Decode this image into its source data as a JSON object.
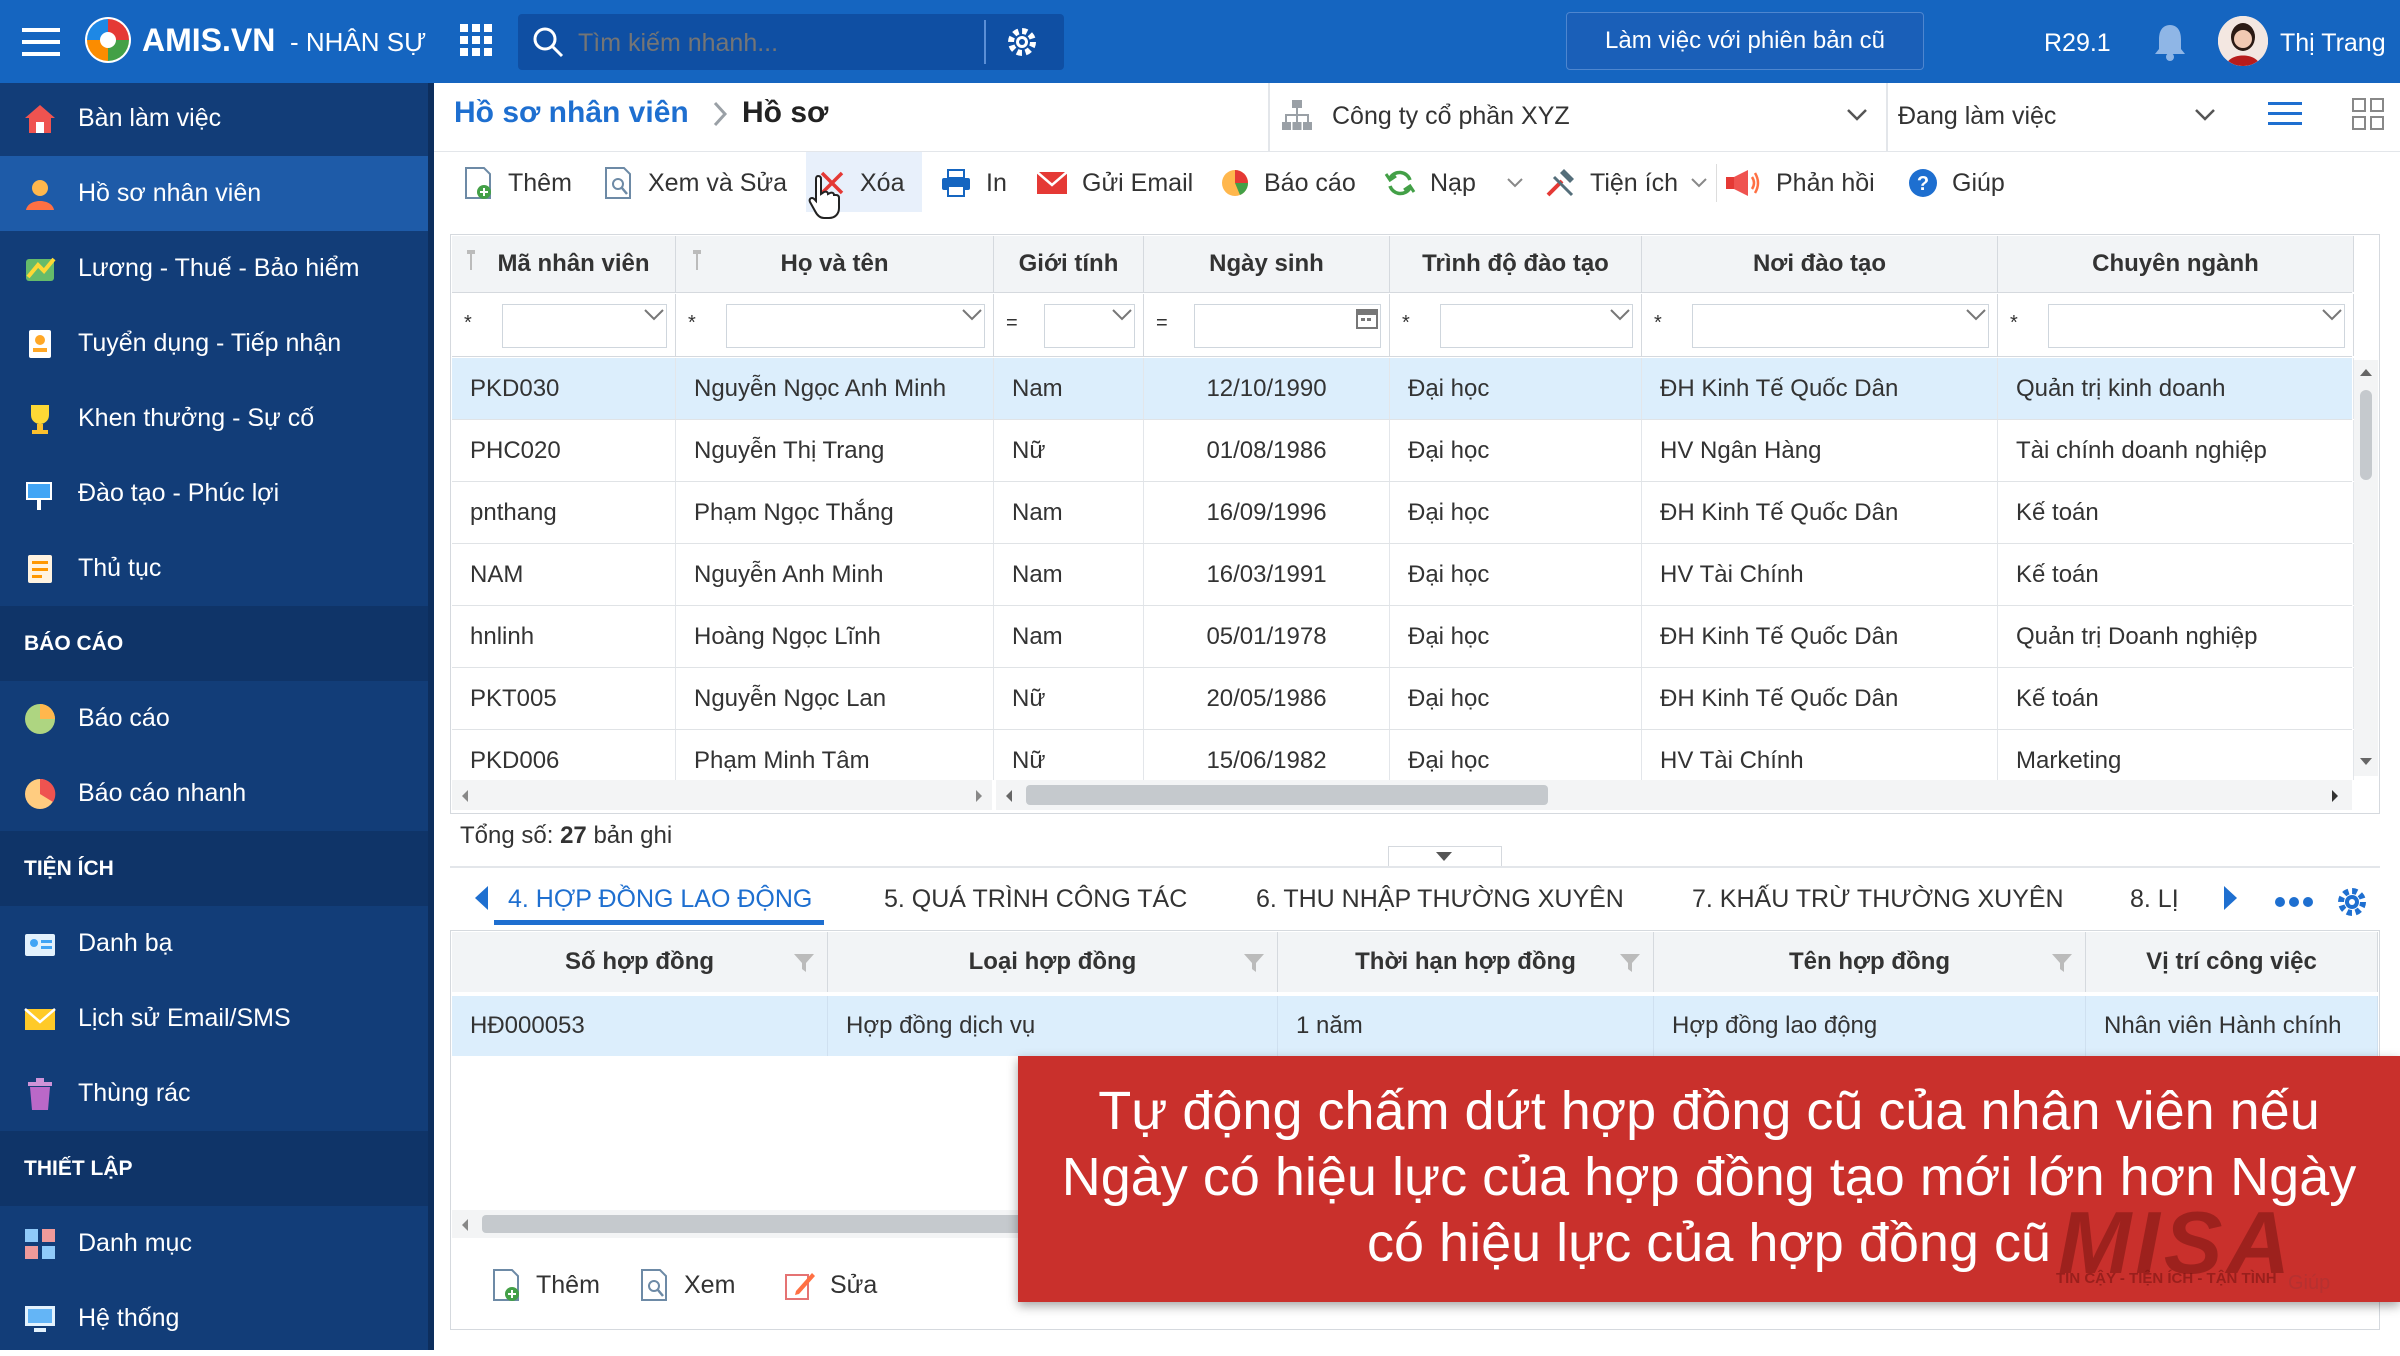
{
  "header": {
    "logo_text": "AMIS.VN",
    "module": "- NHÂN SỰ",
    "search_placeholder": "Tìm kiếm nhanh...",
    "old_version_button": "Làm việc với phiên bản cũ",
    "version": "R29.1",
    "user_name": "Thị Trang"
  },
  "sidebar": {
    "items": [
      {
        "label": "Bàn làm việc",
        "icon": "home-icon"
      },
      {
        "label": "Hồ sơ nhân viên",
        "icon": "employee-icon",
        "active": true
      },
      {
        "label": "Lương - Thuế - Bảo hiểm",
        "icon": "salary-icon"
      },
      {
        "label": "Tuyển dụng - Tiếp nhận",
        "icon": "recruit-icon"
      },
      {
        "label": "Khen thưởng - Sự cố",
        "icon": "trophy-icon"
      },
      {
        "label": "Đào tạo - Phúc lợi",
        "icon": "training-icon"
      },
      {
        "label": "Thủ tục",
        "icon": "procedure-icon"
      }
    ],
    "section_report": "BÁO CÁO",
    "report_items": [
      {
        "label": "Báo cáo",
        "icon": "pie-chart-icon"
      },
      {
        "label": "Báo cáo nhanh",
        "icon": "quick-report-icon"
      }
    ],
    "section_utility": "TIỆN ÍCH",
    "utility_items": [
      {
        "label": "Danh bạ",
        "icon": "contacts-icon"
      },
      {
        "label": "Lịch sử Email/SMS",
        "icon": "mail-icon"
      },
      {
        "label": "Thùng rác",
        "icon": "trash-icon"
      }
    ],
    "section_setup": "THIẾT LẬP",
    "setup_items": [
      {
        "label": "Danh mục",
        "icon": "catalog-icon"
      },
      {
        "label": "Hệ thống",
        "icon": "system-icon"
      }
    ]
  },
  "breadcrumb": {
    "parent": "Hồ sơ nhân viên",
    "current": "Hồ sơ"
  },
  "filters": {
    "company": "Công ty cổ phần XYZ",
    "status": "Đang làm việc"
  },
  "toolbar": {
    "add": "Thêm",
    "view_edit": "Xem và Sửa",
    "delete": "Xóa",
    "print": "In",
    "send_email": "Gửi Email",
    "report": "Báo cáo",
    "load": "Nạp",
    "utility": "Tiện ích",
    "feedback": "Phản hồi",
    "help": "Giúp"
  },
  "grid": {
    "columns": [
      "Mã nhân viên",
      "Họ và tên",
      "Giới tính",
      "Ngày sinh",
      "Trình độ đào tạo",
      "Nơi đào tạo",
      "Chuyên ngành"
    ],
    "filter_ops": [
      "*",
      "*",
      "=",
      "=",
      "*",
      "*",
      "*"
    ],
    "rows": [
      [
        "PKD030",
        "Nguyễn Ngọc Anh Minh",
        "Nam",
        "12/10/1990",
        "Đại học",
        "ĐH Kinh Tế Quốc Dân",
        "Quản trị kinh doanh"
      ],
      [
        "PHC020",
        "Nguyễn Thị Trang",
        "Nữ",
        "01/08/1986",
        "Đại học",
        "HV Ngân Hàng",
        "Tài chính doanh nghiệp"
      ],
      [
        "pnthang",
        "Phạm Ngọc Thắng",
        "Nam",
        "16/09/1996",
        "Đại học",
        "ĐH Kinh Tế Quốc Dân",
        "Kế toán"
      ],
      [
        "NAM",
        "Nguyễn Anh Minh",
        "Nam",
        "16/03/1991",
        "Đại học",
        "HV Tài Chính",
        "Kế toán"
      ],
      [
        "hnlinh",
        "Hoàng Ngọc Lĩnh",
        "Nam",
        "05/01/1978",
        "Đại học",
        "ĐH Kinh Tế Quốc Dân",
        "Quản trị Doanh nghiệp"
      ],
      [
        "PKT005",
        "Nguyễn Ngọc Lan",
        "Nữ",
        "20/05/1986",
        "Đại học",
        "ĐH Kinh Tế Quốc Dân",
        "Kế toán"
      ],
      [
        "PKD006",
        "Phạm Minh Tâm",
        "Nữ",
        "15/06/1982",
        "Đại học",
        "HV Tài Chính",
        "Marketing"
      ]
    ],
    "total_label": "Tổng số:",
    "total_count": "27",
    "total_suffix": "bản ghi"
  },
  "detail_tabs": [
    "4. HỢP ĐỒNG LAO ĐỘNG",
    "5. QUÁ TRÌNH CÔNG TÁC",
    "6. THU NHẬP THƯỜNG XUYÊN",
    "7. KHẤU TRỪ THƯỜNG XUYÊN",
    "8. LỊ"
  ],
  "detail_grid": {
    "columns": [
      "Số hợp đồng",
      "Loại hợp đồng",
      "Thời hạn hợp đồng",
      "Tên hợp đồng",
      "Vị trí công việc"
    ],
    "row": [
      "HĐ000053",
      "Hợp đồng dịch vụ",
      "1 năm",
      "Hợp đồng lao động",
      "Nhân viên Hành chính"
    ]
  },
  "detail_toolbar": {
    "add": "Thêm",
    "view": "Xem",
    "edit": "Sửa"
  },
  "overlay": {
    "line1": "Tự động chấm dứt hợp đồng cũ của nhân viên nếu",
    "line2": "Ngày có hiệu lực của hợp đồng tạo mới lớn hơn Ngày",
    "line3": "có hiệu lực của hợp đồng cũ",
    "watermark": "MISA",
    "watermark_tagline": "TIN CẬY - TIỆN ÍCH - TẬN TÌNH",
    "faint_text": "Giúp"
  },
  "colors": {
    "header_blue": "#1565c0",
    "sidebar_navy": "#123d78",
    "accent_blue": "#1e6fd0",
    "selected_row": "#dceefc",
    "overlay_red": "#c9302c"
  }
}
